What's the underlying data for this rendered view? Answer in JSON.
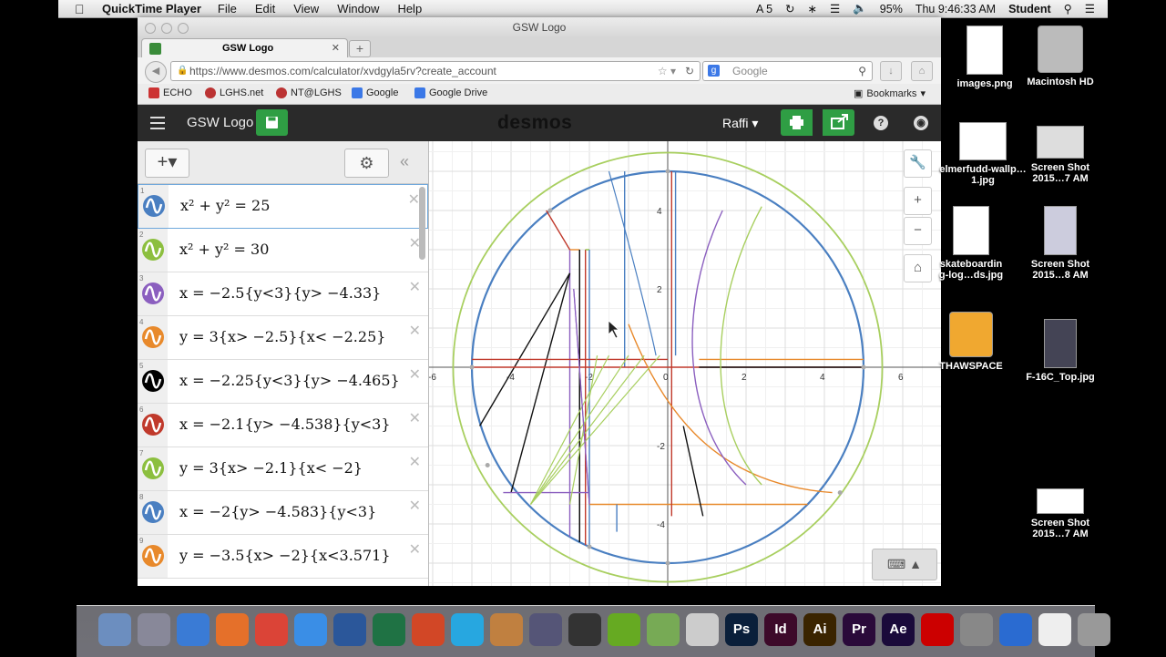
{
  "menubar": {
    "app_name": "QuickTime Player",
    "menus": [
      "File",
      "Edit",
      "View",
      "Window",
      "Help"
    ],
    "status": "95%",
    "clock": "Thu 9:46:33 AM",
    "user": "Student",
    "input_number": "5"
  },
  "browser": {
    "window_title": "GSW Logo",
    "tab_label": "GSW Logo",
    "url": "https://www.desmos.com/calculator/xvdgyla5rv?create_account",
    "search_placeholder": "Google",
    "bookmarks": [
      "ECHO",
      "LGHS.net",
      "NT@LGHS",
      "Google",
      "Google Drive"
    ],
    "bookmarks_menu": "Bookmarks"
  },
  "desmos": {
    "graph_title": "GSW Logo",
    "logo": "desmos",
    "user": "Raffi",
    "expressions": [
      {
        "n": "1",
        "latex": "x² + y² = 25",
        "color": "#4a7fc1"
      },
      {
        "n": "2",
        "latex": "x² + y² = 30",
        "color": "#8cbf3f"
      },
      {
        "n": "3",
        "latex": "x = −2.5{y<3}{y> −4.33}",
        "color": "#8b5fbf"
      },
      {
        "n": "4",
        "latex": "y = 3{x> −2.5}{x< −2.25}",
        "color": "#e8892b"
      },
      {
        "n": "5",
        "latex": "x = −2.25{y<3}{y> −4.465}",
        "color": "#000000"
      },
      {
        "n": "6",
        "latex": "x = −2.1{y> −4.538}{y<3}",
        "color": "#c0392b"
      },
      {
        "n": "7",
        "latex": "y = 3{x> −2.1}{x< −2}",
        "color": "#8cbf3f"
      },
      {
        "n": "8",
        "latex": "x = −2{y> −4.583}{y<3}",
        "color": "#4a7fc1"
      },
      {
        "n": "9",
        "latex": "y = −3.5{x> −2}{x<3.571}",
        "color": "#e8892b"
      }
    ],
    "x_ticks": [
      "-6",
      "-4",
      "-2",
      "0",
      "2",
      "4",
      "6"
    ],
    "y_ticks": [
      "4",
      "2",
      "-2",
      "-4"
    ]
  },
  "desktop": {
    "icons": [
      "images.png",
      "Macintosh HD",
      "elmerfudd-wallp…1.jpg",
      "Screen Shot 2015…7 AM",
      "skateboardin g-log…ds.jpg",
      "Screen Shot 2015…8 AM",
      "THAWSPACE",
      "F-16C_Top.jpg",
      "Screen Shot 2015…7 AM"
    ]
  },
  "dock": {
    "apps": [
      "Finder",
      "Launchpad",
      "Safari",
      "Firefox",
      "Chrome",
      "iTunes",
      "Word",
      "Excel",
      "PowerPoint",
      "blurb",
      "Preview",
      "iPhoto",
      "Final Cut",
      "GarageBand",
      "GIMP",
      "Cube",
      "Ps",
      "Id",
      "Ai",
      "Pr",
      "Ae",
      "Acrobat",
      "Preferences",
      "QuickTime",
      "Documents",
      "Trash"
    ]
  }
}
